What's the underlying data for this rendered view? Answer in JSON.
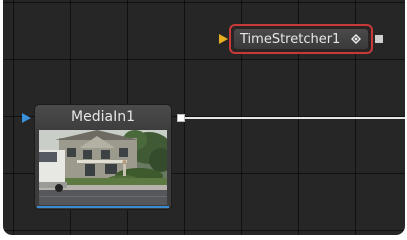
{
  "nodes": {
    "time_stretcher": {
      "title": "TimeStretcher1",
      "icon": "diamond-icon",
      "selected": true,
      "border_color": "#c83a3a",
      "input_color": "#e8b020"
    },
    "media_in": {
      "title": "MediaIn1",
      "input_color": "#3a90d8",
      "thumbnail": "house-street-thumbnail"
    }
  },
  "colors": {
    "canvas_background": "#262626",
    "connection_line": "#e6e6e6"
  }
}
